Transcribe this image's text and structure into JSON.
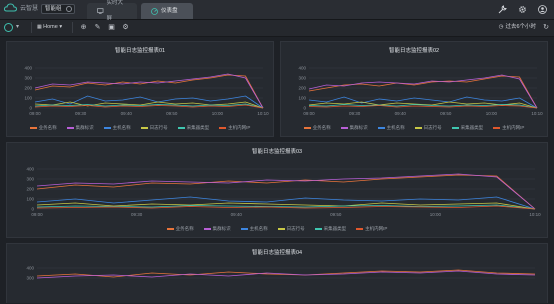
{
  "app": {
    "logo_text": "云智慧",
    "selector_value": "智能组",
    "tabs": [
      {
        "label": "实时大屏",
        "icon": "monitor-icon",
        "active": false
      },
      {
        "label": "仪表盘",
        "icon": "dashboard-icon",
        "active": true
      }
    ],
    "header_icons": [
      "wrench-icon",
      "gear-icon",
      "user-icon"
    ]
  },
  "toolbar": {
    "home_label": "Home",
    "icons": [
      "add-icon",
      "edit-icon",
      "save-icon",
      "settings-icon"
    ],
    "time_range": "过去6个小时",
    "refresh_icon": "refresh-icon"
  },
  "colors": {
    "background": "#1e2126",
    "panel": "#262a30",
    "accent": "#3fbfae",
    "series": [
      "#e8743b",
      "#b85fd6",
      "#3d86e0",
      "#c8c846",
      "#3fc6b0",
      "#e0582d"
    ]
  },
  "panels": [
    {
      "title": "智能日志监控报表01",
      "series_names": [
        "业务名称",
        "集群标识",
        "主机名称",
        "日志行号",
        "采集器类型",
        "主机内网IP"
      ]
    },
    {
      "title": "智能日志监控报表02",
      "series_names": [
        "业务名称",
        "集群标识",
        "主机名称",
        "日志行号",
        "采集器类型",
        "主机内网IP"
      ]
    },
    {
      "title": "智能日志监控报表03",
      "series_names": [
        "业务名称",
        "集群标识",
        "主机名称",
        "日志行号",
        "采集器类型",
        "主机内网IP"
      ]
    },
    {
      "title": "智能日志监控报表04",
      "series_names": [
        "业务名称",
        "集群标识",
        "主机名称",
        "日志行号",
        "采集器类型",
        "主机内网IP"
      ]
    }
  ],
  "chart_data": [
    {
      "type": "line",
      "title": "智能日志监控报表01",
      "x": [
        "09:00",
        "09:30",
        "09:40",
        "09:50",
        "10:00",
        "10:10"
      ],
      "ylim": [
        0,
        400
      ],
      "y_ticks": [
        0,
        100,
        200,
        300,
        400
      ],
      "series": [
        {
          "name": "业务名称",
          "values": [
            180,
            220,
            210,
            250,
            230,
            260,
            240,
            270,
            250,
            280,
            300,
            330,
            320,
            0
          ]
        },
        {
          "name": "集群标识",
          "values": [
            200,
            240,
            230,
            260,
            250,
            240,
            260,
            250,
            270,
            290,
            310,
            340,
            300,
            0
          ]
        },
        {
          "name": "主机名称",
          "values": [
            60,
            90,
            40,
            120,
            70,
            80,
            110,
            60,
            90,
            100,
            70,
            90,
            120,
            0
          ]
        },
        {
          "name": "日志行号",
          "values": [
            40,
            30,
            60,
            20,
            50,
            40,
            30,
            60,
            40,
            50,
            30,
            40,
            60,
            0
          ]
        },
        {
          "name": "采集器类型",
          "values": [
            20,
            30,
            25,
            35,
            20,
            30,
            25,
            35,
            30,
            20,
            30,
            25,
            40,
            0
          ]
        },
        {
          "name": "主机内网IP",
          "values": [
            10,
            20,
            15,
            25,
            10,
            20,
            15,
            25,
            20,
            10,
            20,
            15,
            30,
            0
          ]
        }
      ]
    },
    {
      "type": "line",
      "title": "智能日志监控报表02",
      "x": [
        "09:00",
        "09:30",
        "09:40",
        "09:50",
        "10:00",
        "10:10"
      ],
      "ylim": [
        0,
        400
      ],
      "y_ticks": [
        0,
        100,
        200,
        300,
        400
      ],
      "series": [
        {
          "name": "业务名称",
          "values": [
            170,
            200,
            230,
            240,
            220,
            250,
            230,
            260,
            270,
            260,
            290,
            320,
            310,
            0
          ]
        },
        {
          "name": "集群标识",
          "values": [
            190,
            230,
            220,
            250,
            260,
            250,
            240,
            270,
            260,
            280,
            300,
            330,
            290,
            0
          ]
        },
        {
          "name": "主机名称",
          "values": [
            80,
            60,
            110,
            50,
            90,
            70,
            100,
            80,
            60,
            110,
            80,
            70,
            100,
            0
          ]
        },
        {
          "name": "日志行号",
          "values": [
            30,
            50,
            40,
            60,
            30,
            50,
            40,
            30,
            60,
            40,
            50,
            30,
            50,
            0
          ]
        },
        {
          "name": "采集器类型",
          "values": [
            25,
            20,
            35,
            25,
            30,
            20,
            35,
            25,
            20,
            30,
            25,
            35,
            30,
            0
          ]
        },
        {
          "name": "主机内网IP",
          "values": [
            15,
            10,
            20,
            15,
            25,
            10,
            20,
            15,
            10,
            20,
            15,
            25,
            20,
            0
          ]
        }
      ]
    },
    {
      "type": "line",
      "title": "智能日志监控报表03",
      "x": [
        "09:00",
        "09:30",
        "09:40",
        "09:50",
        "10:00",
        "10:10"
      ],
      "ylim": [
        0,
        400
      ],
      "y_ticks": [
        0,
        100,
        200,
        300,
        400
      ],
      "series": [
        {
          "name": "业务名称",
          "values": [
            200,
            240,
            220,
            260,
            250,
            280,
            260,
            290,
            270,
            300,
            320,
            340,
            330,
            0
          ]
        },
        {
          "name": "集群标识",
          "values": [
            230,
            260,
            250,
            280,
            270,
            260,
            290,
            280,
            300,
            310,
            330,
            350,
            320,
            0
          ]
        },
        {
          "name": "主机名称",
          "values": [
            70,
            100,
            60,
            90,
            120,
            80,
            70,
            110,
            90,
            80,
            100,
            90,
            120,
            0
          ]
        },
        {
          "name": "日志行号",
          "values": [
            40,
            60,
            30,
            50,
            40,
            60,
            50,
            40,
            30,
            60,
            40,
            50,
            60,
            0
          ]
        },
        {
          "name": "采集器类型",
          "values": [
            20,
            30,
            25,
            20,
            35,
            30,
            25,
            20,
            30,
            35,
            25,
            30,
            40,
            0
          ]
        },
        {
          "name": "主机内网IP",
          "values": [
            10,
            15,
            20,
            10,
            25,
            15,
            20,
            10,
            15,
            25,
            20,
            15,
            30,
            0
          ]
        }
      ]
    },
    {
      "type": "line",
      "title": "智能日志监控报表04",
      "x": [],
      "ylim": [
        0,
        400
      ],
      "y_ticks": [
        300,
        400
      ],
      "series": [
        {
          "name": "业务名称",
          "values": [
            320,
            340,
            310,
            350,
            330,
            360,
            340,
            330,
            350,
            370,
            360,
            380,
            350,
            340
          ]
        },
        {
          "name": "集群标识",
          "values": [
            300,
            320,
            330,
            310,
            340,
            320,
            350,
            330,
            340,
            360,
            350,
            370,
            340,
            330
          ]
        }
      ]
    }
  ]
}
